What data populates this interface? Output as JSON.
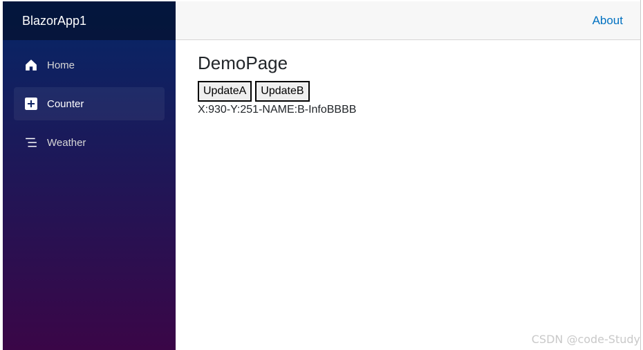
{
  "app": {
    "brand": "BlazorApp1"
  },
  "sidebar": {
    "items": [
      {
        "label": "Home",
        "icon": "home-icon"
      },
      {
        "label": "Counter",
        "icon": "plus-square-icon",
        "active": true
      },
      {
        "label": "Weather",
        "icon": "list-icon"
      }
    ]
  },
  "header": {
    "about_label": "About"
  },
  "page": {
    "title": "DemoPage",
    "buttons": {
      "update_a": "UpdateA",
      "update_b": "UpdateB"
    },
    "info_text": "X:930-Y:251-NAME:B-InfoBBBB"
  },
  "watermark": "CSDN @code-Study",
  "colors": {
    "sidebar_top": "#052767",
    "sidebar_bottom": "#3a0647",
    "link": "#0071c1"
  }
}
